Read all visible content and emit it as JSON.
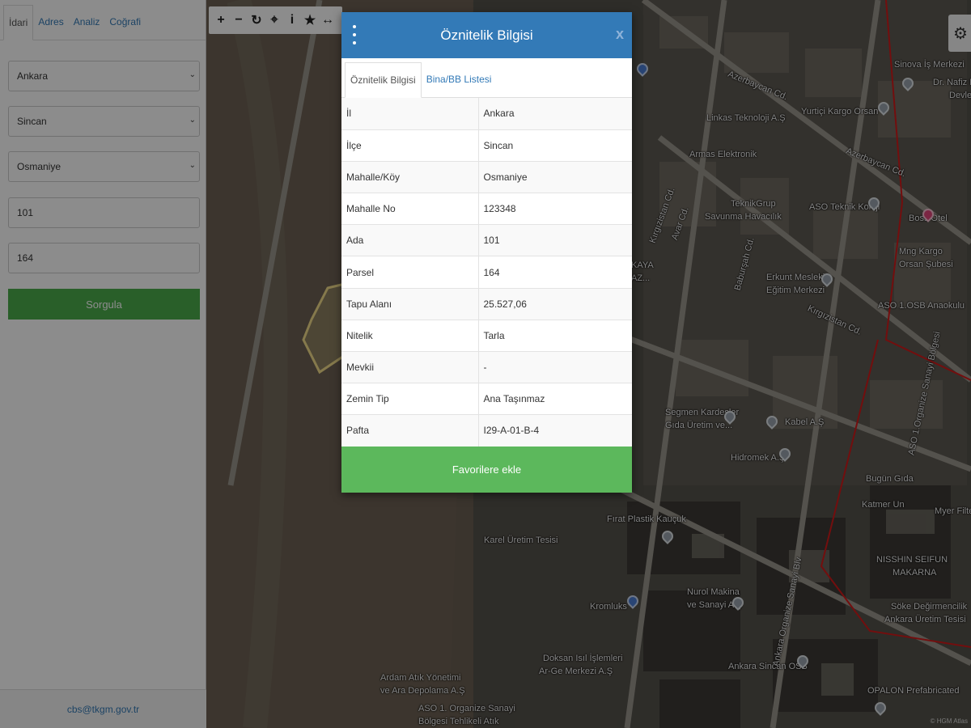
{
  "sidebar": {
    "tabs": [
      {
        "label": "İdari",
        "active": true
      },
      {
        "label": "Adres",
        "active": false
      },
      {
        "label": "Analiz",
        "active": false
      },
      {
        "label": "Coğrafi",
        "active": false
      }
    ],
    "il_value": "Ankara",
    "ilce_value": "Sincan",
    "mahalle_value": "Osmaniye",
    "ada_value": "101",
    "parsel_value": "164",
    "query_label": "Sorgula",
    "footer_email": "cbs@tkgm.gov.tr"
  },
  "map": {
    "toolbar_icons": [
      "plus-icon",
      "minus-icon",
      "refresh-icon",
      "locate-icon",
      "info-icon",
      "star-icon",
      "measure-icon"
    ],
    "attribution": "© HGM Atlas",
    "labels": [
      "Sinova İş Merkezi",
      "Dr. Nafiz K.",
      "Devlet",
      "Azerbaycan Cd.",
      "Yurtiçi Kargo Orsan",
      "Linkas Teknoloji A.Ş",
      "Armas Elektronik",
      "Azerbaycan Cd.",
      "TeknikGrup",
      "Savunma Havacılık",
      "ASO Teknik Koleji",
      "Boss Otel",
      "Kırgızistan Cd.",
      "Avar Cd.",
      "Erkunt Mesleki",
      "Eğitim Merkezi",
      "Mng Kargo",
      "Orsan Şubesi",
      "Baburşah Cd.",
      "ASO 1.OSB Anaokulu",
      "Kırgızistan Cd.",
      "Segmen Kardeşler",
      "Gıda Üretim ve...",
      "Kabel A.Ş",
      "Hidromek A.Ş",
      "Bugün Gıda",
      "Katmer Un",
      "Myer Filter",
      "Fırat Plastik Kauçuk",
      "Karel Üretim Tesisi",
      "NISSHIN SEIFUN",
      "MAKARNA",
      "Nurol Makina",
      "ve Sanayi A.Ş",
      "Kromluks",
      "Söke Değirmencilik",
      "Ankara Üretim Tesisi",
      "Doksan Isıl İşlemleri",
      "Ar-Ge Merkezi A.Ş",
      "Ankara Sincan OSB",
      "Ardam Atık Yönetimi",
      "ve Ara Depolama A.Ş",
      "ASO 1. Organize Sanayi",
      "Bölgesi Tehlikeli Atık",
      "OPALON Prefabricated",
      "KAYA",
      "AZ...",
      "ASO 1.Organize Sanayi Bölgesi",
      "Ankara Organize Sanayi Blv"
    ]
  },
  "dialog": {
    "title": "Öznitelik Bilgisi",
    "close_label": "x",
    "tabs": [
      {
        "label": "Öznitelik Bilgisi",
        "active": true
      },
      {
        "label": "Bina/BB Listesi",
        "active": false
      }
    ],
    "rows": [
      {
        "key": "İl",
        "value": "Ankara"
      },
      {
        "key": "İlçe",
        "value": "Sincan"
      },
      {
        "key": "Mahalle/Köy",
        "value": "Osmaniye"
      },
      {
        "key": "Mahalle No",
        "value": "123348"
      },
      {
        "key": "Ada",
        "value": "101"
      },
      {
        "key": "Parsel",
        "value": "164"
      },
      {
        "key": "Tapu Alanı",
        "value": "25.527,06"
      },
      {
        "key": "Nitelik",
        "value": "Tarla"
      },
      {
        "key": "Mevkii",
        "value": "-"
      },
      {
        "key": "Zemin Tip",
        "value": "Ana Taşınmaz"
      },
      {
        "key": "Pafta",
        "value": "I29-A-01-B-4"
      }
    ],
    "favorite_label": "Favorilere ekle"
  },
  "colors": {
    "header_blue": "#337ab7",
    "button_green": "#5cb85c",
    "query_green": "#4cae4c",
    "parcel_outline": "#f3dd8a",
    "osb_boundary": "#d11a1a"
  }
}
